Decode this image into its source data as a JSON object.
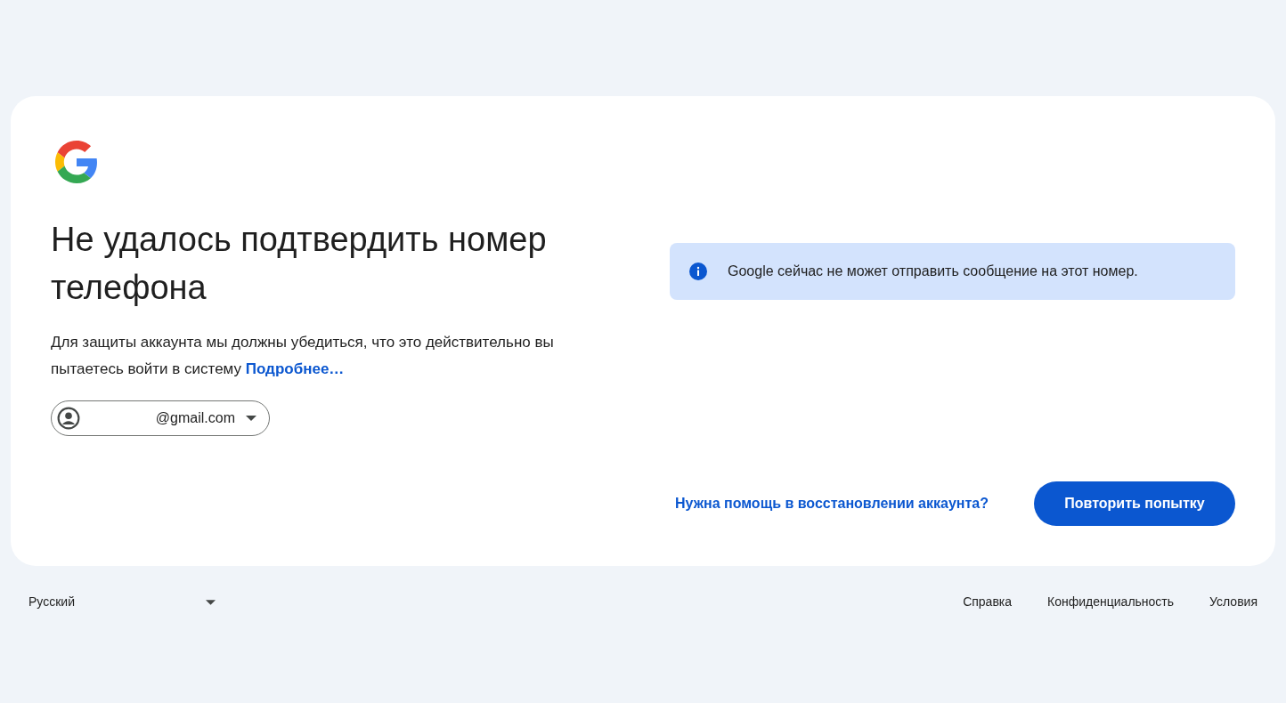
{
  "card": {
    "heading": "Не удалось подтвердить номер телефона",
    "description": "Для защиты аккаунта мы должны убедиться, что это действительно вы пытаетесь войти в систему",
    "learn_more_link": "Подробнее…",
    "account": {
      "email": "@gmail.com"
    },
    "info_message": "Google сейчас не может отправить сообщение на этот номер.",
    "recovery_link": "Нужна помощь в восстановлении аккаунта?",
    "retry_button": "Повторить попытку"
  },
  "footer": {
    "language": "Русский",
    "links": [
      "Справка",
      "Конфиденциальность",
      "Условия"
    ]
  }
}
